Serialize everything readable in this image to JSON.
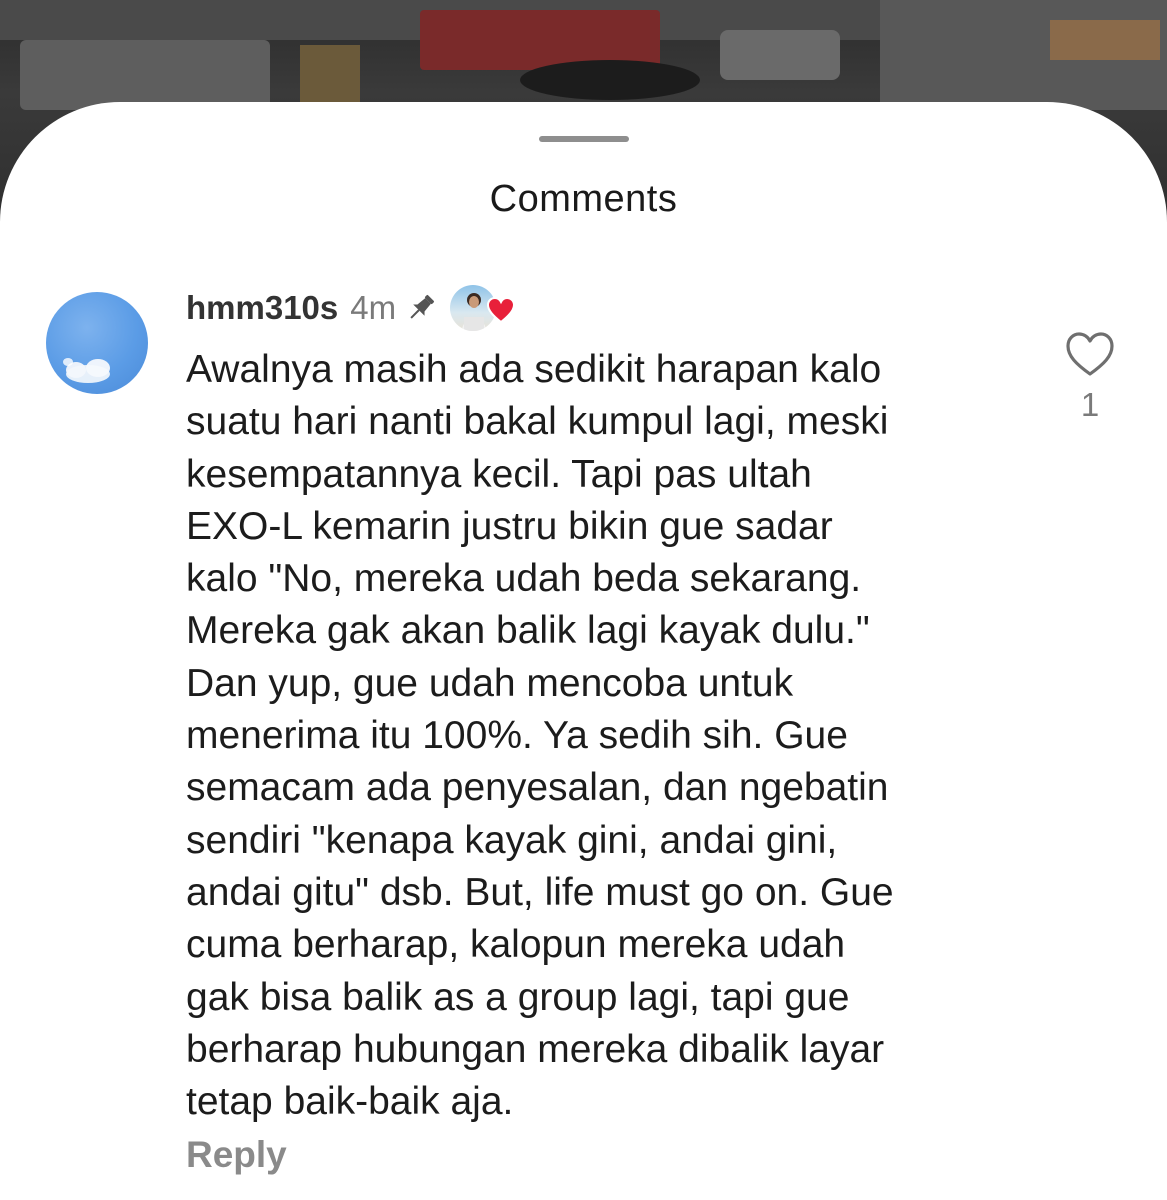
{
  "sheet": {
    "title": "Comments"
  },
  "comment": {
    "username": "hmm310s",
    "time": "4m",
    "text": "Awalnya masih ada sedikit harapan kalo\nsuatu hari nanti bakal kumpul lagi, meski\nkesempatannya kecil. Tapi  pas ultah\nEXO-L kemarin justru bikin gue sadar\nkalo \"No, mereka udah beda sekarang.\nMereka gak akan balik lagi kayak dulu.\"\nDan yup, gue udah mencoba untuk\nmenerima itu 100%. Ya sedih sih. Gue\nsemacam ada penyesalan, dan ngebatin\nsendiri \"kenapa kayak gini, andai gini,\nandai gitu\" dsb. But, life must go on. Gue\ncuma berharap, kalopun mereka  udah\ngak bisa balik as a group lagi, tapi gue\nberharap hubungan mereka dibalik layar\ntetap baik-baik aja.",
    "reply_label": "Reply",
    "like_count": "1",
    "pinned": true,
    "liked_by_author": true
  },
  "icons": {
    "pin": "pin-icon",
    "heart_outline": "heart-outline-icon",
    "heart_filled": "heart-filled-icon"
  },
  "colors": {
    "sheet_background": "#ffffff",
    "text_primary": "#1c1c1c",
    "text_secondary": "#7a7a7a",
    "heart_red": "#e8203a",
    "avatar_blue": "#5b9ce6"
  }
}
